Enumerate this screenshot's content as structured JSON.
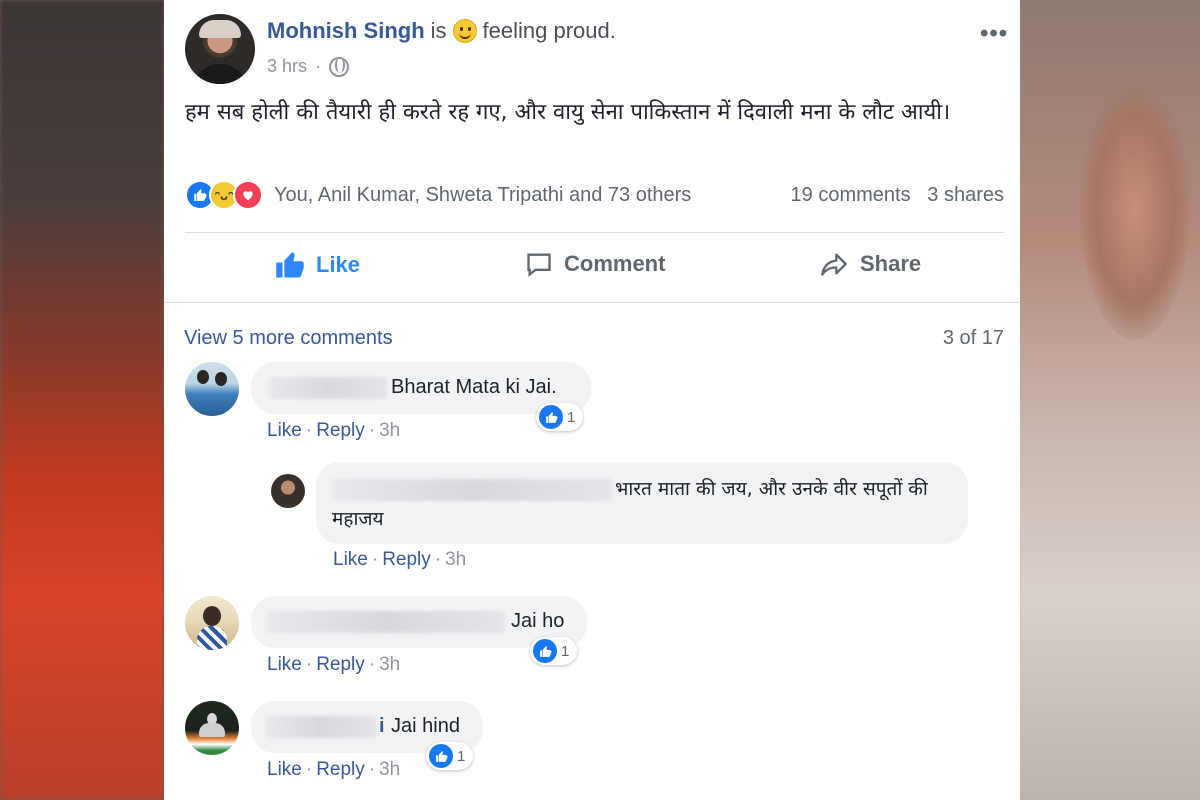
{
  "post": {
    "author": "Mohnish Singh",
    "activity_is": "is",
    "activity": "feeling proud.",
    "time": "3 hrs",
    "body": "हम सब होली की तैयारी ही करते रह गए, और वायु सेना पाकिस्तान में दिवाली मना के लौट आयी।",
    "reaction_names": "You, Anil Kumar, Shweta Tripathi and 73 others",
    "comments_count": "19 comments",
    "shares_count": "3 shares"
  },
  "actions": {
    "like": "Like",
    "comment": "Comment",
    "share": "Share"
  },
  "comments_section": {
    "view_more": "View 5 more comments",
    "pager": "3 of 17"
  },
  "comments": [
    {
      "text": "Bharat Mata ki Jai.",
      "like": "Like",
      "reply": "Reply",
      "time": "3h",
      "reactions": "1"
    },
    {
      "text": "भारत माता की जय, और उनके वीर सपूतों की महाजय",
      "like": "Like",
      "reply": "Reply",
      "time": "3h"
    },
    {
      "text": "Jai ho",
      "like": "Like",
      "reply": "Reply",
      "time": "3h",
      "reactions": "1"
    },
    {
      "name_tail": "i",
      "text": "Jai hind",
      "like": "Like",
      "reply": "Reply",
      "time": "3h",
      "reactions": "1"
    }
  ],
  "colors": {
    "link": "#385898",
    "like_blue": "#1877f2",
    "muted": "#606770",
    "bubble": "#f2f3f5"
  }
}
